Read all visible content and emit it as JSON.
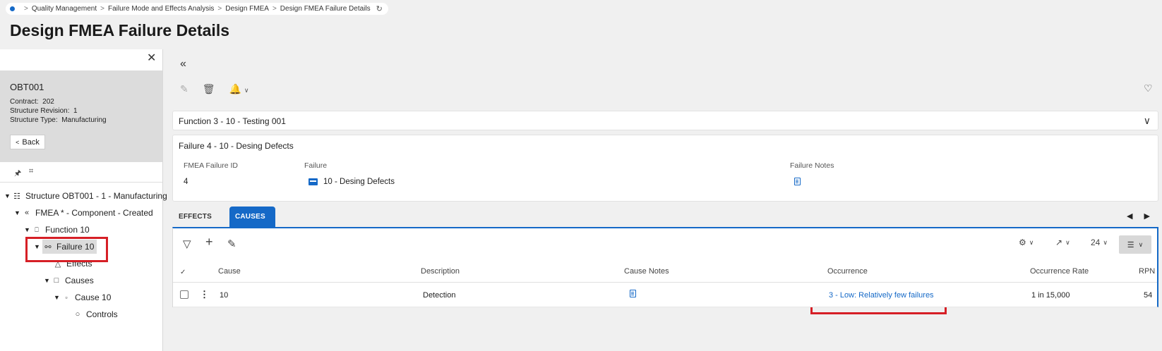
{
  "breadcrumb": {
    "items": [
      "Quality Management",
      "Failure Mode and Effects Analysis",
      "Design FMEA",
      "Design FMEA Failure Details"
    ],
    "refresh_icon": "refresh-icon"
  },
  "page_title": "Design FMEA Failure Details",
  "left_panel": {
    "record": {
      "title": "OBT001",
      "contract_label": "Contract:",
      "contract_value": "202",
      "revision_label": "Structure Revision:",
      "revision_value": "1",
      "type_label": "Structure Type:",
      "type_value": "Manufacturing"
    },
    "back_label": "Back",
    "tree": [
      {
        "label": "Structure OBT001 - 1 - Manufacturing",
        "icon": "structure-icon",
        "level": 0
      },
      {
        "label": "FMEA * - Component - Created",
        "icon": "fmea-icon",
        "level": 1
      },
      {
        "label": "Function 10",
        "icon": "function-icon",
        "level": 2
      },
      {
        "label": "Failure 10",
        "icon": "failure-icon",
        "level": 3,
        "selected": true
      },
      {
        "label": "Effects",
        "icon": "triangle-icon",
        "level": 4
      },
      {
        "label": "Causes",
        "icon": "square-icon",
        "level": 4
      },
      {
        "label": "Cause 10",
        "icon": "small-square-icon",
        "level": 5
      },
      {
        "label": "Controls",
        "icon": "circle-icon",
        "level": 6
      }
    ]
  },
  "function_bar": {
    "label": "Function 3 - 10 - Testing 001"
  },
  "failure_card": {
    "header": "Failure 4 - 10 - Desing Defects",
    "fields": {
      "id_label": "FMEA Failure ID",
      "id_value": "4",
      "failure_label": "Failure",
      "failure_value": "10 - Desing Defects",
      "notes_label": "Failure Notes"
    }
  },
  "tabs": [
    {
      "label": "EFFECTS",
      "active": false
    },
    {
      "label": "CAUSES",
      "active": true
    }
  ],
  "grid": {
    "page_size": "24",
    "columns": [
      "Cause",
      "Description",
      "Cause Notes",
      "Occurrence",
      "Occurrence Rate",
      "RPN"
    ],
    "rows": [
      {
        "cause": "10",
        "description": "Detection",
        "occurrence": "3 - Low: Relatively few failures",
        "occurrence_rate": "1 in 15,000",
        "rpn": "54"
      }
    ]
  },
  "colors": {
    "accent": "#1569c7",
    "highlight_box": "#d61f26",
    "selected_bg": "#dcdcdc"
  }
}
